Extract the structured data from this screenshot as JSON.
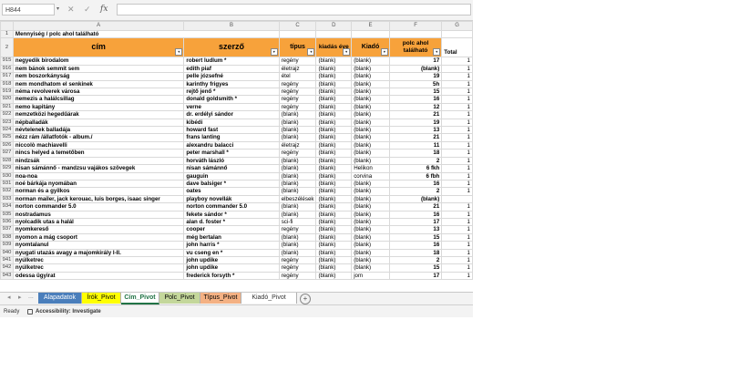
{
  "formula_bar": {
    "name_box": "H844",
    "cancel_glyph": "✕",
    "enter_glyph": "✓",
    "fx_label": "fx",
    "formula": ""
  },
  "columns": [
    "A",
    "B",
    "C",
    "D",
    "E",
    "F",
    "G"
  ],
  "title_row": {
    "row": "1",
    "text": "Mennyiség / polc ahol található"
  },
  "header_row": {
    "row": "2",
    "cells": [
      "cím",
      "szerző",
      "típus",
      "kiadás éve",
      "Kiadó",
      "polc ahol található",
      "Total"
    ]
  },
  "rows": [
    {
      "r": "915",
      "a": "negyedik birodalom",
      "b": "robert ludlum    *",
      "c": "regény",
      "d": "(blank)",
      "e": "(blank)",
      "f": "17",
      "g": "1"
    },
    {
      "r": "916",
      "a": "nem bánok semmit sem",
      "b": "edith piaf",
      "c": "életrajz",
      "d": "(blank)",
      "e": "(blank)",
      "f": "(blank)",
      "g": "1"
    },
    {
      "r": "917",
      "a": "nem boszorkányság",
      "b": "pelle józsefné",
      "c": "étel",
      "d": "(blank)",
      "e": "(blank)",
      "f": "19",
      "g": "1"
    },
    {
      "r": "918",
      "a": "nem mondhatom el senkinek",
      "b": "karinthy frigyes",
      "c": "regény",
      "d": "(blank)",
      "e": "(blank)",
      "f": "5h",
      "g": "1"
    },
    {
      "r": "919",
      "a": "néma revolverek városa",
      "b": "rejtő jenő     *",
      "c": "regény",
      "d": "(blank)",
      "e": "(blank)",
      "f": "15",
      "g": "1"
    },
    {
      "r": "920",
      "a": "nemezis a halálcsillag",
      "b": "donald goldsmith    *",
      "c": "regény",
      "d": "(blank)",
      "e": "(blank)",
      "f": "16",
      "g": "1"
    },
    {
      "r": "921",
      "a": "nemo kapitány",
      "b": "verne",
      "c": "regény",
      "d": "(blank)",
      "e": "(blank)",
      "f": "12",
      "g": "1"
    },
    {
      "r": "922",
      "a": "nemzetközi hegedűárak",
      "b": "dr. erdélyi sándor",
      "c": "(blank)",
      "d": "(blank)",
      "e": "(blank)",
      "f": "21",
      "g": "1"
    },
    {
      "r": "923",
      "a": "népballadák",
      "b": "kibédi",
      "c": "(blank)",
      "d": "(blank)",
      "e": "(blank)",
      "f": "19",
      "g": "1"
    },
    {
      "r": "924",
      "a": "névtelenek balladája",
      "b": "howard fast",
      "c": "(blank)",
      "d": "(blank)",
      "e": "(blank)",
      "f": "13",
      "g": "1"
    },
    {
      "r": "925",
      "a": "nézz rám  /állatfotók - album./",
      "b": "frans lanting",
      "c": "(blank)",
      "d": "(blank)",
      "e": "(blank)",
      "f": "21",
      "g": "1"
    },
    {
      "r": "926",
      "a": "niccolò machiavelli",
      "b": "alexandru balacci",
      "c": "életrajz",
      "d": "(blank)",
      "e": "(blank)",
      "f": "11",
      "g": "1"
    },
    {
      "r": "927",
      "a": "nincs helyed a temetőben",
      "b": "peter marshall    *",
      "c": "regény",
      "d": "(blank)",
      "e": "(blank)",
      "f": "18",
      "g": "1"
    },
    {
      "r": "928",
      "a": "nindzsák",
      "b": "horváth lászló",
      "c": "(blank)",
      "d": "(blank)",
      "e": "(blank)",
      "f": "2",
      "g": "1"
    },
    {
      "r": "929",
      "a": "nisan sámánnő - mandzsu vajákos szövegek",
      "b": "nisan sámánnő",
      "c": "(blank)",
      "d": "(blank)",
      "e": "Helikon",
      "f": "6 fkh",
      "g": "1"
    },
    {
      "r": "930",
      "a": "noa-noa",
      "b": "gauguin",
      "c": "(blank)",
      "d": "(blank)",
      "e": "corvina",
      "f": "6 fbh",
      "g": "1"
    },
    {
      "r": "931",
      "a": "noé bárkája nyomában",
      "b": "dave balsiger    *",
      "c": "(blank)",
      "d": "(blank)",
      "e": "(blank)",
      "f": "16",
      "g": "1"
    },
    {
      "r": "932",
      "a": "norman és a gyilkos",
      "b": "oates",
      "c": "(blank)",
      "d": "(blank)",
      "e": "(blank)",
      "f": "2",
      "g": "1"
    },
    {
      "r": "933",
      "a": "norman mailer, jack kerouac, luis borges, isaac singer",
      "b": "playboy novellák",
      "c": "elbeszélések",
      "d": "(blank)",
      "e": "(blank)",
      "f": "(blank)",
      "g": ""
    },
    {
      "r": "934",
      "a": "norton commander 5.0",
      "b": "norton commander 5.0",
      "c": "(blank)",
      "d": "(blank)",
      "e": "(blank)",
      "f": "21",
      "g": "1"
    },
    {
      "r": "935",
      "a": "nostradamus",
      "b": "fekete sándor    *",
      "c": "(blank)",
      "d": "(blank)",
      "e": "(blank)",
      "f": "16",
      "g": "1"
    },
    {
      "r": "936",
      "a": "nyolcadik utas a halál",
      "b": "alan d. foster    *",
      "c": "sci-fi",
      "d": "(blank)",
      "e": "(blank)",
      "f": "17",
      "g": "1"
    },
    {
      "r": "937",
      "a": "nyomkereső",
      "b": "cooper",
      "c": "regény",
      "d": "(blank)",
      "e": "(blank)",
      "f": "13",
      "g": "1"
    },
    {
      "r": "938",
      "a": "nyomon a mág csoport",
      "b": "még bertalan",
      "c": "(blank)",
      "d": "(blank)",
      "e": "(blank)",
      "f": "15",
      "g": "1"
    },
    {
      "r": "939",
      "a": "nyomtalanul",
      "b": "john harris    *",
      "c": "(blank)",
      "d": "(blank)",
      "e": "(blank)",
      "f": "16",
      "g": "1"
    },
    {
      "r": "940",
      "a": "nyugati utazás avagy a majomkirály I-II.",
      "b": "vu cseng en    *",
      "c": "(blank)",
      "d": "(blank)",
      "e": "(blank)",
      "f": "18",
      "g": "1"
    },
    {
      "r": "941",
      "a": "nyúlketrec",
      "b": "john updike",
      "c": "regény",
      "d": "(blank)",
      "e": "(blank)",
      "f": "2",
      "g": "1"
    },
    {
      "r": "942",
      "a": "nyúlketrec",
      "b": "john updike",
      "c": "regény",
      "d": "(blank)",
      "e": "(blank)",
      "f": "15",
      "g": "1"
    },
    {
      "r": "943",
      "a": "odessa ügyirat",
      "b": "frederick forsyth    *",
      "c": "regény",
      "d": "(blank)",
      "e": "jom",
      "f": "17",
      "g": "1"
    }
  ],
  "sheet_tabs": [
    {
      "label": "Alapadatok",
      "bg": "#4a7ebb",
      "fg": "#ffffff",
      "active": false
    },
    {
      "label": "Írók_Pivot",
      "bg": "#ffff00",
      "fg": "#000000",
      "active": false
    },
    {
      "label": "Cím_Pivot",
      "bg": "#ffffff",
      "fg": "#217346",
      "active": true
    },
    {
      "label": "Polc_Pivot",
      "bg": "#c4d79b",
      "fg": "#000000",
      "active": false
    },
    {
      "label": "Típus_Pivot",
      "bg": "#f4b183",
      "fg": "#000000",
      "active": false
    },
    {
      "label": "Kiadó_Pivot",
      "bg": "#ffffff",
      "fg": "#333333",
      "active": false
    }
  ],
  "add_sheet": "+",
  "nav": {
    "prev": "◂",
    "next": "▸",
    "more": "..."
  },
  "status": {
    "ready": "Ready",
    "accessibility": "Accessibility: Investigate"
  },
  "colors": {
    "header_orange": "#f7a23b",
    "excel_green": "#217346"
  },
  "icons": {
    "dropdown": "filter-dropdown-icon",
    "accessibility": "accessibility-icon"
  }
}
